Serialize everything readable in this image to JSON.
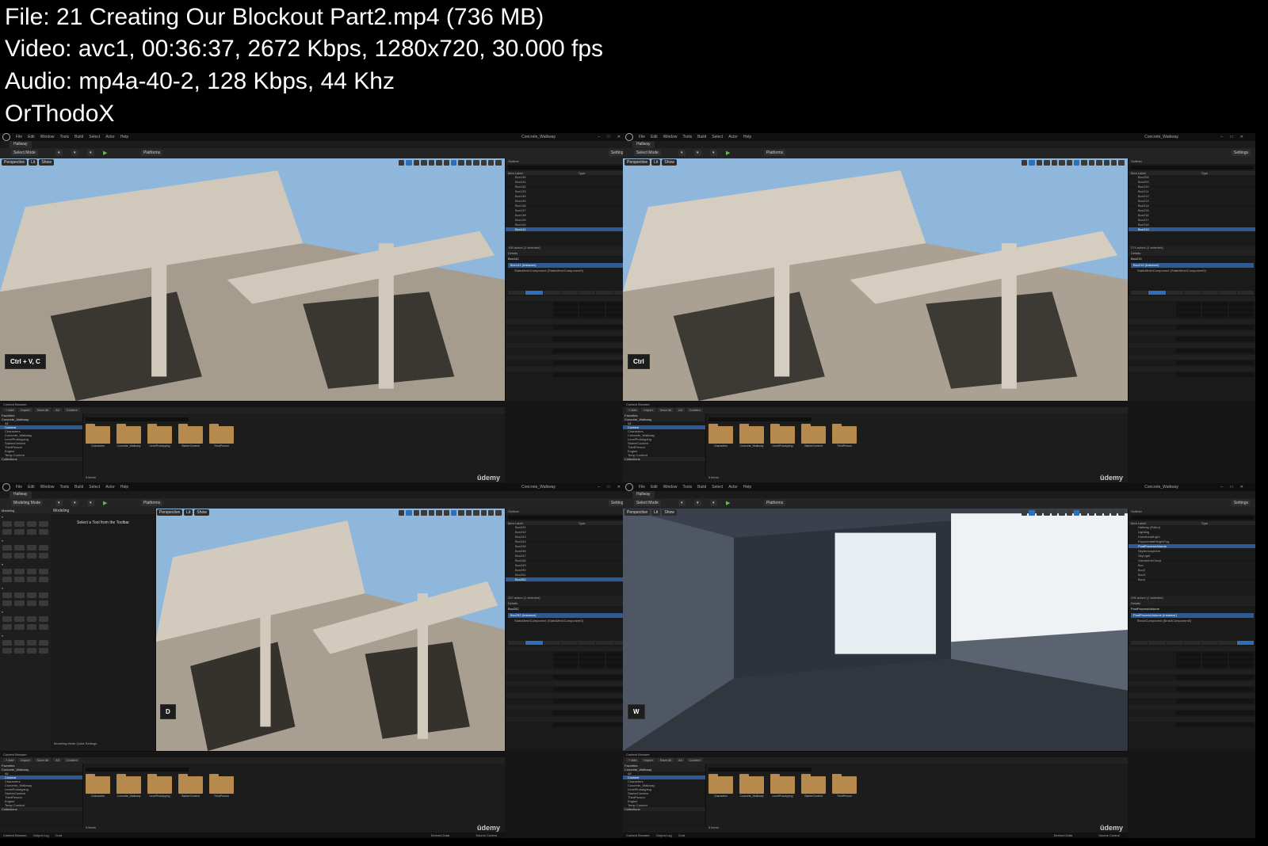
{
  "header": {
    "line1": "File: 21  Creating Our Blockout Part2.mp4 (736 MB)",
    "line2": "Video: avc1, 00:36:37, 2672 Kbps, 1280x720, 30.000 fps",
    "line3": "Audio: mp4a-40-2, 128 Kbps, 44 Khz",
    "line4": "OrThodoX"
  },
  "editor": {
    "menus": [
      "File",
      "Edit",
      "Window",
      "Tools",
      "Build",
      "Select",
      "Actor",
      "Help"
    ],
    "project": "Concrete_Walkway",
    "level": "Hallway",
    "select_mode": "Select Mode",
    "modeling_mode": "Modeling Mode",
    "platforms": "Platforms",
    "settings": "Settings",
    "viewport_perspective": "Perspective",
    "viewport_lit": "Lit",
    "viewport_show": "Show",
    "outliner_title": "Outliner",
    "outliner_item_label": "Item Label",
    "outliner_type": "Type",
    "details_title": "Details",
    "add_button": "+ Add",
    "content_browser": "Content Browser",
    "output_log": "Output Log",
    "cmd": "Cmd",
    "import": "Import",
    "save_all": "Save All",
    "all": "All",
    "content": "Content",
    "favorites": "Favorites",
    "collections": "Collections",
    "folders": [
      "Characters",
      "Concrete_Walkway",
      "LevelPrototyping",
      "StarterContent",
      "ThirdPerson"
    ],
    "tree": [
      "All",
      "Content",
      "Characters",
      "Concrete_Walkway",
      "LevelPrototyping",
      "StarterContent",
      "ThirdPerson",
      "Engine",
      "Temp Content"
    ],
    "items_count": "5 items",
    "udemy": "ûdemy",
    "derived_data": "Derived Data",
    "source_control": "Source Control"
  },
  "thumbnails": [
    {
      "key": "Ctrl + V, C",
      "actor": "Box141",
      "actor_instance": "Box141 (Instance)",
      "component": "StaticMeshComponent (StaticMeshComponent0)",
      "outliner_rows": [
        "Box130",
        "Box131",
        "Box132",
        "Box133",
        "Box134",
        "Box135",
        "Box136",
        "Box137",
        "Box138",
        "Box139",
        "Box140",
        "Box141"
      ],
      "actors_footer": "195 actors (1 selected)",
      "location": [
        "-1800",
        "-3660",
        "150"
      ],
      "rotation": [
        "0.0",
        "0.0",
        "0.0"
      ],
      "scale": [
        "1.0",
        "1.0",
        "1.0"
      ]
    },
    {
      "key": "Ctrl",
      "actor": "Box219",
      "actor_instance": "Box219 (Instance)",
      "component": "StaticMeshComponent (StaticMeshComponent0)",
      "outliner_rows": [
        "Box208",
        "Box209",
        "Box210",
        "Box211",
        "Box212",
        "Box213",
        "Box214",
        "Box215",
        "Box216",
        "Box217",
        "Box218",
        "Box219"
      ],
      "actors_footer": "274 actors (1 selected)",
      "location": [
        "-750.0",
        "-1420.0",
        "150.0"
      ],
      "rotation": [
        "0.0",
        "0.0",
        "0.0"
      ],
      "scale": [
        "1.0",
        "1.0",
        "1.0"
      ]
    },
    {
      "key": "D",
      "actor": "Box252",
      "actor_instance": "Box252 (Instance)",
      "component": "StaticMeshComponent (StaticMeshComponent0)",
      "outliner_rows": [
        "Box241",
        "Box242",
        "Box243",
        "Box244",
        "Box245",
        "Box246",
        "Box247",
        "Box248",
        "Box249",
        "Box250",
        "Box251",
        "Box252"
      ],
      "actors_footer": "257 actors (1 selected)",
      "modeling_title": "Modeling",
      "modeling_message": "Select a Tool from the Toolbar",
      "modeling_settings": "Modeling Mode Quick Settings",
      "location": [
        "-230.0",
        "-2970.0",
        "270.0"
      ],
      "rotation": [
        "0.0",
        "0.0",
        "0.0"
      ],
      "scale": [
        "1.0",
        "1.0",
        "1.0"
      ]
    },
    {
      "key": "W",
      "actor": "PostProcessVolume",
      "actor_instance": "PostProcessVolume (Instance)",
      "component": "BrushComponent (BrushComponent0)",
      "outliner_rows": [
        "Hallway (Editor)",
        "Lighting",
        "DirectionalLight",
        "ExponentialHeightFog",
        "PostProcessVolume",
        "SkyAtmosphere",
        "SkyLight",
        "VolumetricCloud",
        "Box",
        "Box2",
        "Box3",
        "Box4"
      ],
      "actors_footer": "296 actors (1 selected)",
      "location": [
        "-570.0",
        "-880.0",
        "150.0"
      ],
      "rotation": [
        "0.0",
        "0.0",
        "0.0"
      ],
      "scale": [
        "1.0",
        "1.0",
        "1.0"
      ]
    }
  ]
}
